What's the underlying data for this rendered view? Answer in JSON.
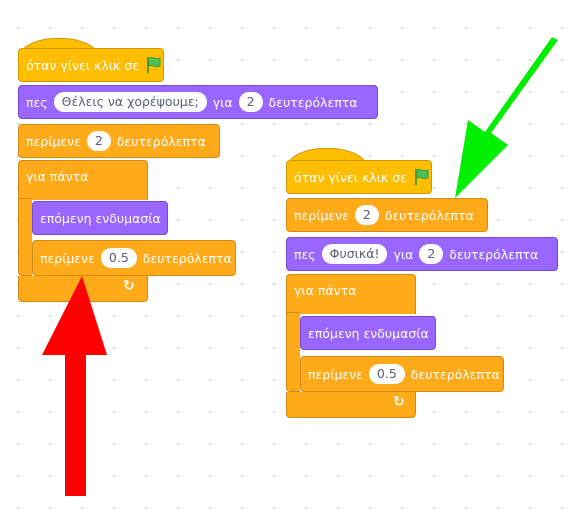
{
  "scripts": [
    {
      "hat": {
        "label": "όταν γίνει κλικ σε",
        "icon": "green-flag-icon"
      },
      "say": {
        "label": "πες",
        "message": "Θέλεις να χορέψουμε;",
        "for_label": "για",
        "secs": "2",
        "unit": "δευτερόλεπτα"
      },
      "wait": {
        "label": "περίμενε",
        "secs": "2",
        "unit": "δευτερόλεπτα"
      },
      "forever": {
        "label": "για πάντα",
        "next_costume": "επόμενη ενδυμασία",
        "wait": {
          "label": "περίμενε",
          "secs": "0.5",
          "unit": "δευτερόλεπτα"
        },
        "loop_icon": "loop-arrow-icon"
      }
    },
    {
      "hat": {
        "label": "όταν γίνει κλικ σε",
        "icon": "green-flag-icon"
      },
      "wait": {
        "label": "περίμενε",
        "secs": "2",
        "unit": "δευτερόλεπτα"
      },
      "say": {
        "label": "πες",
        "message": "Φυσικά!",
        "for_label": "για",
        "secs": "2",
        "unit": "δευτερόλεπτα"
      },
      "forever": {
        "label": "για πάντα",
        "next_costume": "επόμενη ενδυμασία",
        "wait": {
          "label": "περίμενε",
          "secs": "0.5",
          "unit": "δευτερόλεπτα"
        },
        "loop_icon": "loop-arrow-icon"
      }
    }
  ],
  "annotations": [
    {
      "name": "green-arrow",
      "color": "#00ee00"
    },
    {
      "name": "red-arrow",
      "color": "#ff0000"
    }
  ],
  "colors": {
    "events": "#ffbf00",
    "control": "#ffab19",
    "looks": "#9966ff",
    "workspace": "#ffffff"
  }
}
